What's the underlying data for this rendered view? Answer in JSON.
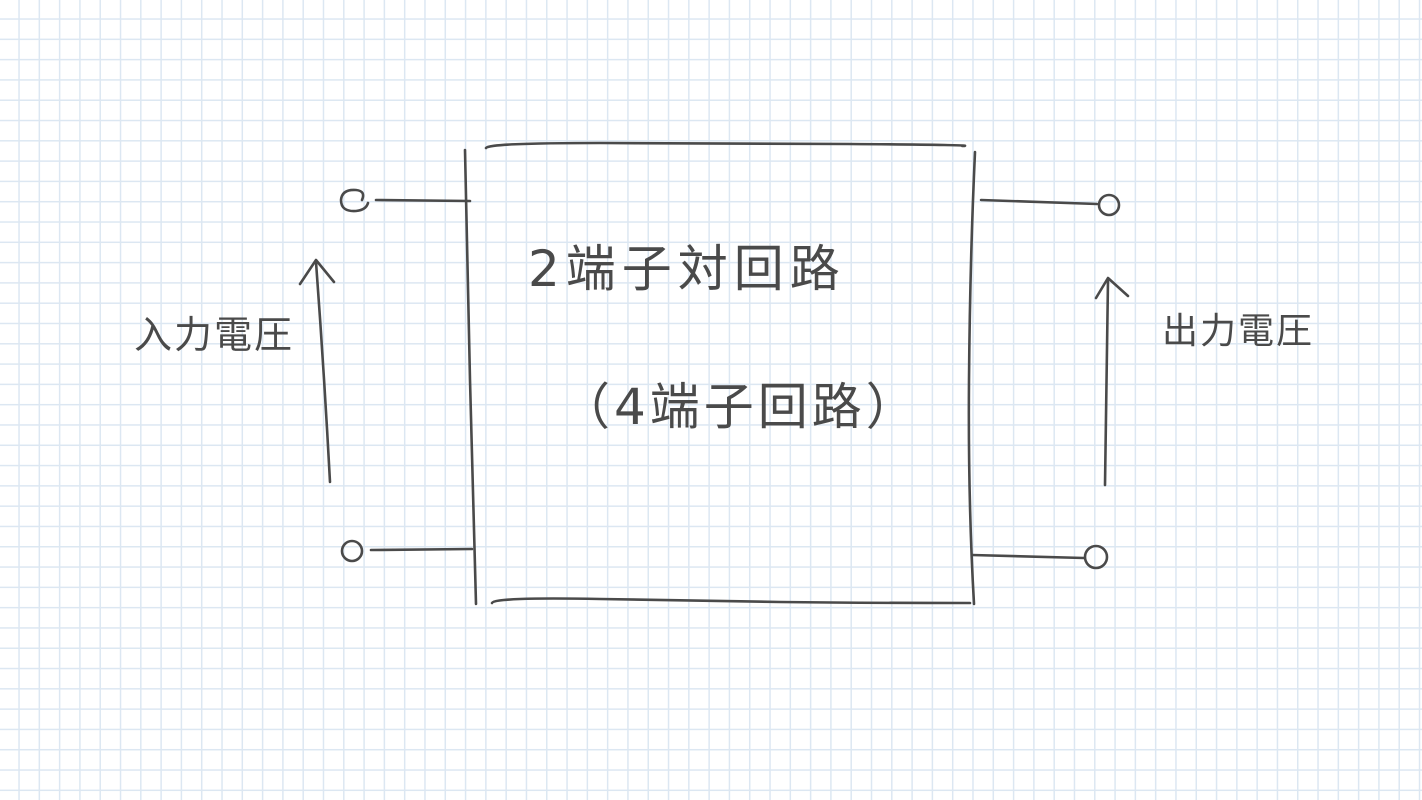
{
  "diagram": {
    "title": "2端子対回路",
    "subtitle": "（4端子回路）",
    "input_label": "入力電圧",
    "output_label": "出力電圧"
  },
  "colors": {
    "ink": "#4a4a4a",
    "grid_line": "#dce7f2",
    "paper": "#ffffff"
  }
}
